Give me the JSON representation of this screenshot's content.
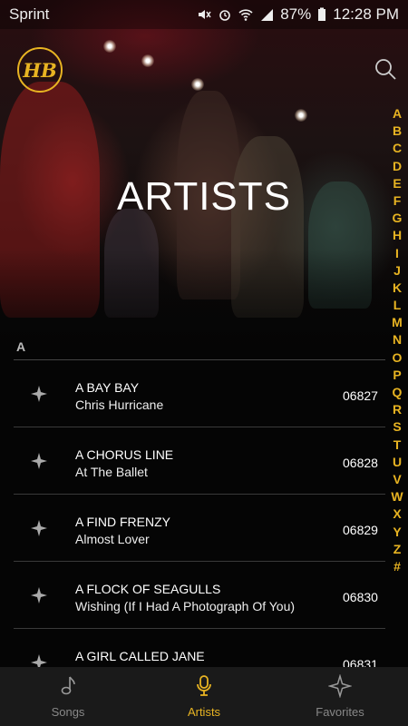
{
  "status_bar": {
    "carrier": "Sprint",
    "battery": "87%",
    "time": "12:28 PM"
  },
  "header": {
    "logo_text": "HB",
    "title": "ARTISTS"
  },
  "alphabet_index": [
    "A",
    "B",
    "C",
    "D",
    "E",
    "F",
    "G",
    "H",
    "I",
    "J",
    "K",
    "L",
    "M",
    "N",
    "O",
    "P",
    "Q",
    "R",
    "S",
    "T",
    "U",
    "V",
    "W",
    "X",
    "Y",
    "Z",
    "#"
  ],
  "section": {
    "letter": "A"
  },
  "rows": [
    {
      "title": "A BAY BAY",
      "artist": "Chris Hurricane",
      "number": "06827"
    },
    {
      "title": "A CHORUS LINE",
      "artist": "At The Ballet",
      "number": "06828"
    },
    {
      "title": "A FIND FRENZY",
      "artist": "Almost Lover",
      "number": "06829"
    },
    {
      "title": "A FLOCK OF SEAGULLS",
      "artist": "Wishing (If I Had A Photograph Of You)",
      "number": "06830"
    },
    {
      "title": "A GIRL CALLED JANE",
      "artist": "",
      "number": "06831"
    }
  ],
  "nav": [
    {
      "label": "Songs",
      "icon": "music-note-icon"
    },
    {
      "label": "Artists",
      "icon": "microphone-icon"
    },
    {
      "label": "Favorites",
      "icon": "star-icon"
    }
  ],
  "colors": {
    "accent": "#e8b422",
    "background": "#050505",
    "nav_background": "#1a1a1a"
  }
}
